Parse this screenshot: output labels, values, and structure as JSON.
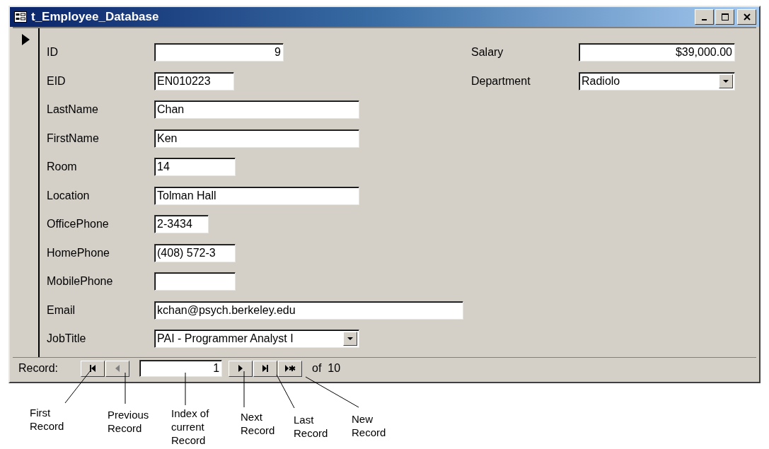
{
  "window": {
    "title": "t_Employee_Database"
  },
  "record_selector": {
    "current": true
  },
  "fields": [
    {
      "label": "ID",
      "kind": "text",
      "value": "9",
      "right_aligned": true
    },
    {
      "label": "EID",
      "kind": "text",
      "value": "EN010223"
    },
    {
      "label": "LastName",
      "kind": "text",
      "value": "Chan"
    },
    {
      "label": "FirstName",
      "kind": "text",
      "value": "Ken"
    },
    {
      "label": "Room",
      "kind": "text",
      "value": "14"
    },
    {
      "label": "Location",
      "kind": "text",
      "value": "Tolman Hall"
    },
    {
      "label": "OfficePhone",
      "kind": "text",
      "value": "2-3434"
    },
    {
      "label": "HomePhone",
      "kind": "text",
      "value": "(408) 572-3"
    },
    {
      "label": "MobilePhone",
      "kind": "text"
    },
    {
      "label": "Email",
      "kind": "text",
      "value": "kchan@psych.berkeley.edu"
    },
    {
      "label": "JobTitle",
      "kind": "combo",
      "value": "PAI - Programmer Analyst I"
    }
  ],
  "side_fields": [
    {
      "label": "Salary",
      "kind": "text",
      "value": "$39,000.00",
      "right_aligned": true
    },
    {
      "label": "Department",
      "kind": "combo",
      "value": "Radiolo"
    }
  ],
  "navigation": {
    "label": "Record:",
    "buttons_before": [
      {
        "kind": "first",
        "disabled": false
      },
      {
        "kind": "previous",
        "disabled": true
      }
    ],
    "index": "1",
    "buttons_after": [
      {
        "kind": "next",
        "disabled": false
      },
      {
        "kind": "last",
        "disabled": false
      },
      {
        "kind": "new",
        "disabled": false
      }
    ],
    "total": "of  10"
  },
  "annotations": [
    {
      "kind": "first",
      "text": "First Record"
    },
    {
      "kind": "previous",
      "text": "Previous Record"
    },
    {
      "kind": "index",
      "text": "Index of current Record"
    },
    {
      "kind": "next",
      "text": "Next Record"
    },
    {
      "kind": "last",
      "text": "Last Record"
    },
    {
      "kind": "new",
      "text": "New Record"
    }
  ]
}
